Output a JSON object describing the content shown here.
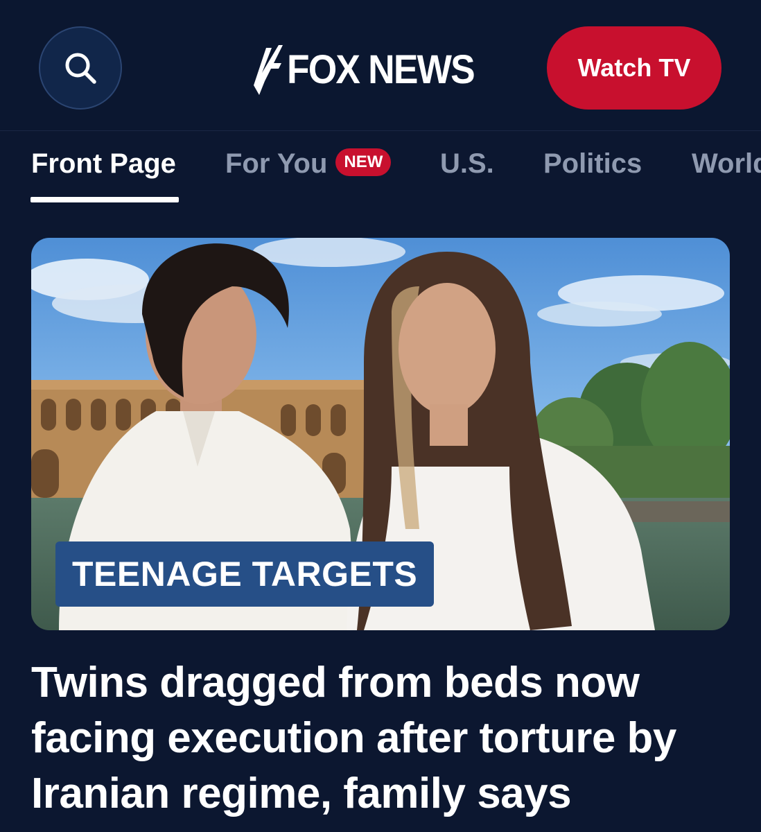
{
  "header": {
    "brand": "FOX NEWS",
    "watch_label": "Watch TV",
    "search_icon": "search-icon"
  },
  "tabs": [
    {
      "label": "Front Page",
      "active": true
    },
    {
      "label": "For You",
      "badge": "NEW"
    },
    {
      "label": "U.S."
    },
    {
      "label": "Politics"
    },
    {
      "label": "World"
    }
  ],
  "story": {
    "kicker": "TEENAGE TARGETS",
    "headline": "Twins dragged from beds now facing execution after torture by Iranian regime, family says"
  },
  "colors": {
    "background": "#0c1730",
    "accent_red": "#c8102e",
    "kicker_blue": "#264f87"
  }
}
